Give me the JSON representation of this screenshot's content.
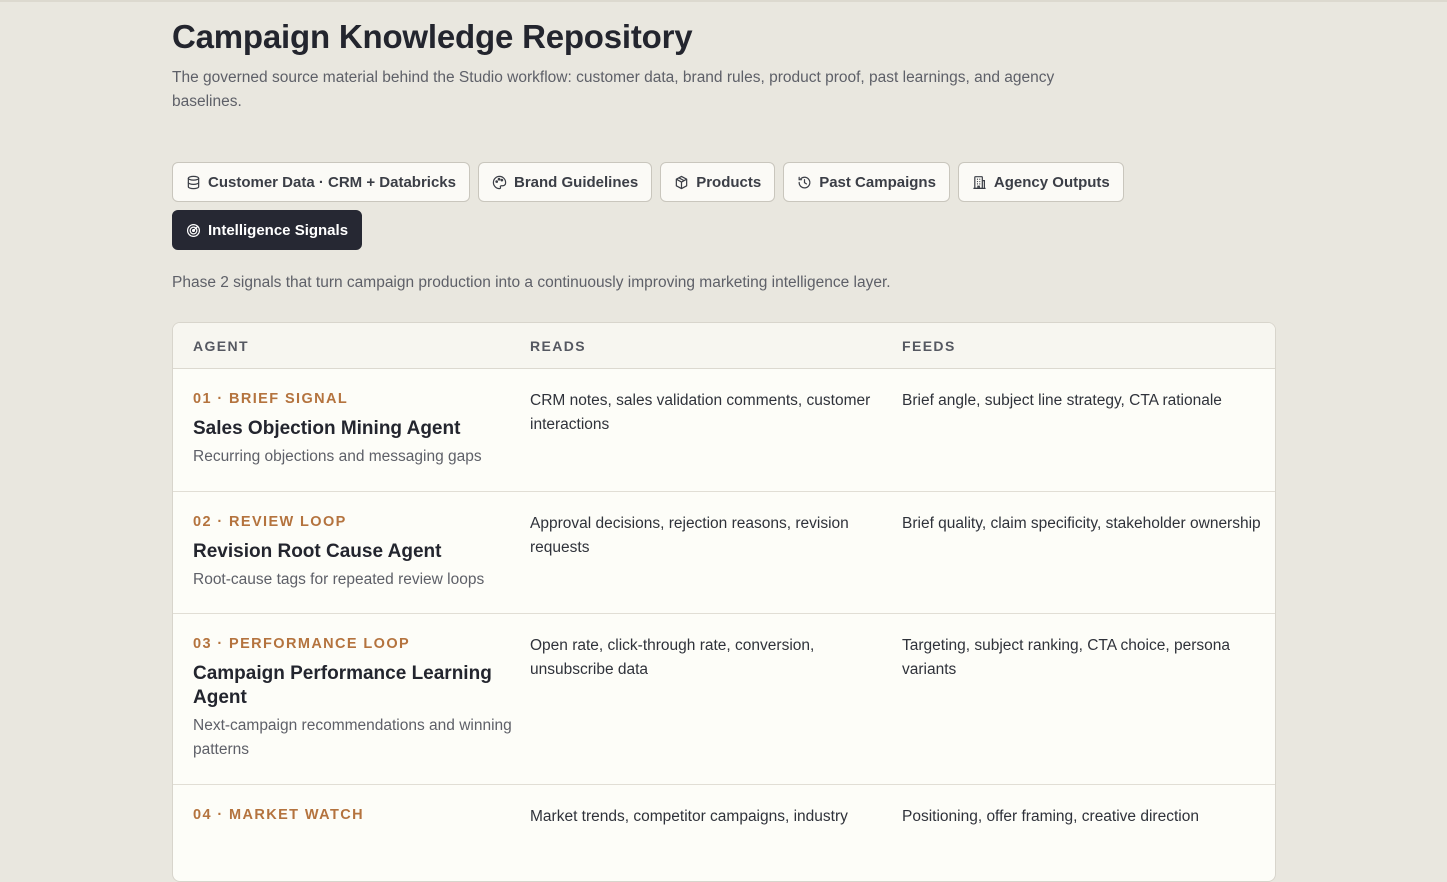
{
  "header": {
    "title": "Campaign Knowledge Repository",
    "subtitle": "The governed source material behind the Studio workflow: customer data, brand rules, product proof, past learnings, and agency baselines."
  },
  "tabs": [
    {
      "label": "Customer Data · CRM + Databricks",
      "icon": "database-icon",
      "active": false
    },
    {
      "label": "Brand Guidelines",
      "icon": "palette-icon",
      "active": false
    },
    {
      "label": "Products",
      "icon": "package-icon",
      "active": false
    },
    {
      "label": "Past Campaigns",
      "icon": "history-icon",
      "active": false
    },
    {
      "label": "Agency Outputs",
      "icon": "building-icon",
      "active": false
    },
    {
      "label": "Intelligence Signals",
      "icon": "radar-icon",
      "active": true
    }
  ],
  "signals": {
    "description": "Phase 2 signals that turn campaign production into a continuously improving marketing intelligence layer."
  },
  "table": {
    "columns": [
      "AGENT",
      "READS",
      "FEEDS"
    ],
    "rows": [
      {
        "tag": "01 · BRIEF SIGNAL",
        "name": "Sales Objection Mining Agent",
        "desc": "Recurring objections and messaging gaps",
        "reads": "CRM notes, sales validation comments, customer interactions",
        "feeds": "Brief angle, subject line strategy, CTA rationale"
      },
      {
        "tag": "02 · REVIEW LOOP",
        "name": "Revision Root Cause Agent",
        "desc": "Root-cause tags for repeated review loops",
        "reads": "Approval decisions, rejection reasons, revision requests",
        "feeds": "Brief quality, claim specificity, stakeholder ownership"
      },
      {
        "tag": "03 · PERFORMANCE LOOP",
        "name": "Campaign Performance Learning Agent",
        "desc": "Next-campaign recommendations and winning patterns",
        "reads": "Open rate, click-through rate, conversion, unsubscribe data",
        "feeds": "Targeting, subject ranking, CTA choice, persona variants"
      },
      {
        "tag": "04 · MARKET WATCH",
        "name": "",
        "desc": "",
        "reads": "Market trends, competitor campaigns, industry",
        "feeds": "Positioning, offer framing, creative direction"
      }
    ]
  },
  "colors": {
    "background": "#e9e7df",
    "accent_tag": "#b4733e",
    "active_tab": "#262833"
  }
}
